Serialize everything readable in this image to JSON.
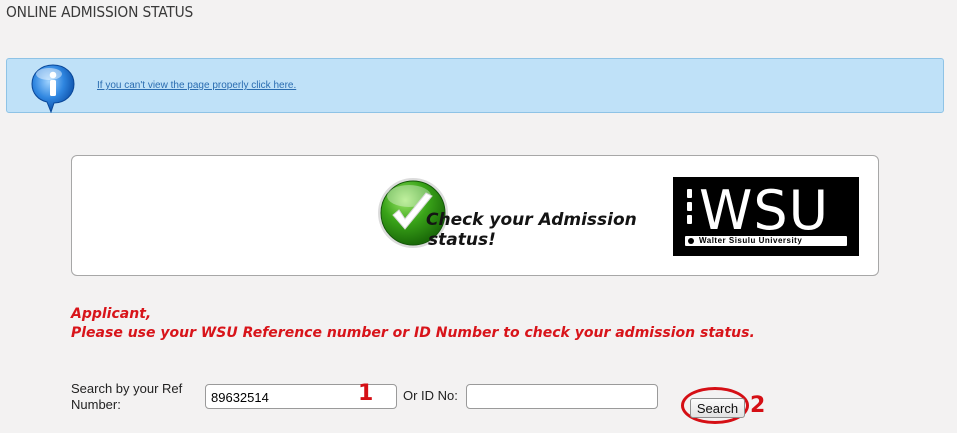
{
  "page": {
    "title": "ONLINE ADMISSION STATUS"
  },
  "info_bar": {
    "icon": "info-icon",
    "link_text": "If you can't view the page properly click here."
  },
  "banner": {
    "icon": "checkmark-icon",
    "heading_line1": "Check your Admission",
    "heading_line2": "status!",
    "logo": {
      "wordmark": "WSU",
      "subtitle": "Walter Sisulu University"
    }
  },
  "notice": {
    "line1": "Applicant,",
    "line2": "Please use your WSU Reference number or ID Number to check your admission status.",
    "color": "#d8141a"
  },
  "search_form": {
    "ref_label": "Search by your Ref Number:",
    "ref_value": "89632514",
    "id_label": "Or ID No:",
    "id_value": "",
    "button_label": "Search"
  },
  "annotations": {
    "marker_1": "1",
    "marker_2": "2",
    "color": "#d50f15"
  }
}
